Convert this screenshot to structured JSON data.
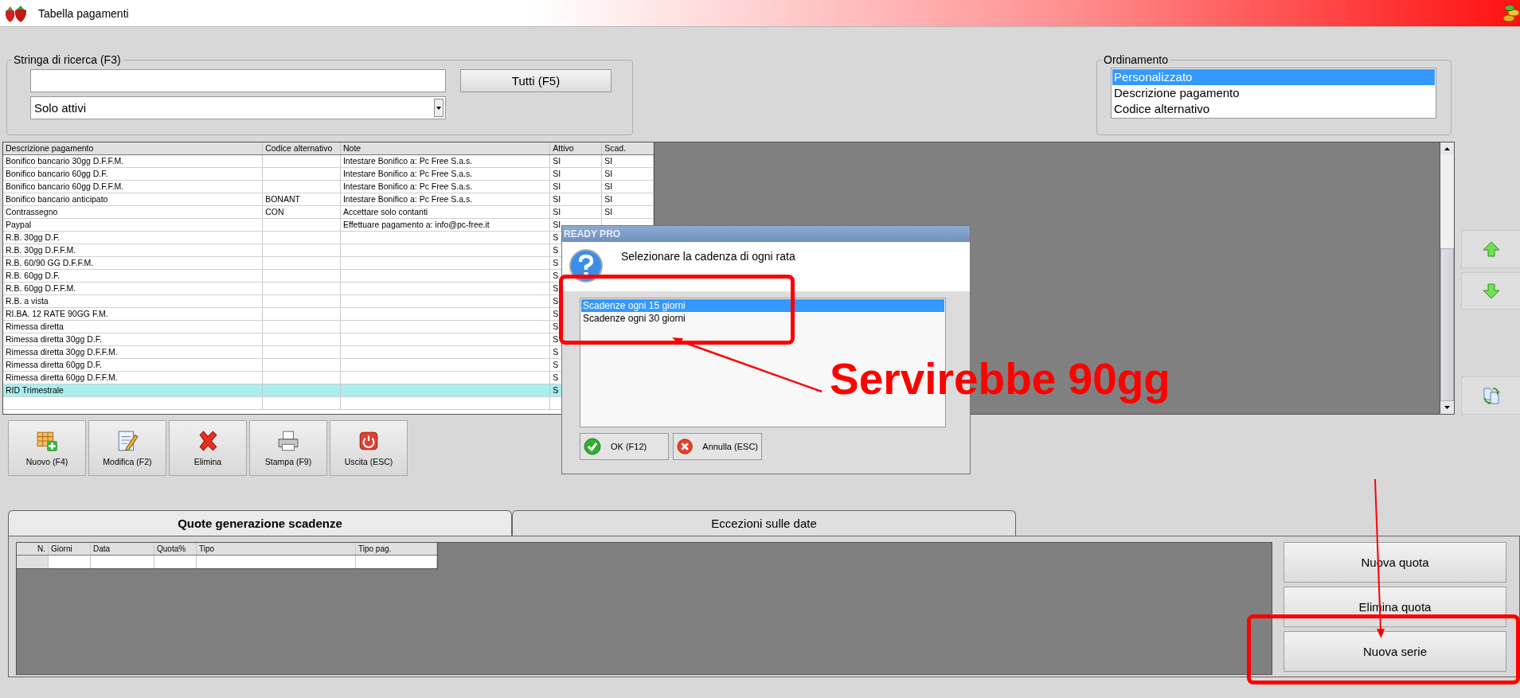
{
  "window": {
    "title": "Tabella pagamenti"
  },
  "search": {
    "group_label": "Stringa di ricerca (F3)",
    "button": "Tutti (F5)",
    "filter": "Solo attivi"
  },
  "sort": {
    "group_label": "Ordinamento",
    "options": [
      {
        "label": "Personalizzato",
        "selected": true
      },
      {
        "label": "Descrizione pagamento",
        "selected": false
      },
      {
        "label": "Codice alternativo",
        "selected": false
      }
    ]
  },
  "table": {
    "columns": [
      "Descrizione pagamento",
      "Codice alternativo",
      "Note",
      "Attivo",
      "Scad."
    ],
    "rows": [
      {
        "description": "Bonifico bancario 30gg D.F.F.M.",
        "note": "Intestare Bonifico a: Pc Free S.a.s.",
        "active": "SI",
        "due": "SI",
        "selected": false
      },
      {
        "description": "Bonifico bancario 60gg D.F.",
        "note": "Intestare Bonifico a: Pc Free S.a.s.",
        "active": "SI",
        "due": "SI",
        "selected": false
      },
      {
        "description": "Bonifico bancario 60gg D.F.F.M.",
        "note": "Intestare Bonifico a: Pc Free S.a.s.",
        "active": "SI",
        "due": "SI",
        "selected": false
      },
      {
        "description": "Bonifico bancario anticipato",
        "code": "BONANT",
        "note": "Intestare Bonifico a: Pc Free S.a.s.",
        "active": "SI",
        "due": "SI",
        "selected": false
      },
      {
        "description": "Contrassegno",
        "code": "CON",
        "note": "Accettare solo contanti",
        "active": "SI",
        "due": "SI",
        "selected": false
      },
      {
        "description": "Paypal",
        "note": "Effettuare pagamento a: info@pc-free.it",
        "active": "SI",
        "selected": false
      },
      {
        "description": "R.B. 30gg D.F.",
        "active": "S",
        "selected": false
      },
      {
        "description": "R.B. 30gg D.F.F.M.",
        "active": "S",
        "selected": false
      },
      {
        "description": "R.B. 60/90 GG D.F.F.M.",
        "active": "S",
        "selected": false
      },
      {
        "description": "R.B. 60gg D.F.",
        "active": "S",
        "selected": false
      },
      {
        "description": "R.B. 60gg D.F.F.M.",
        "active": "S",
        "selected": false
      },
      {
        "description": "R.B. a vista",
        "active": "S",
        "selected": false
      },
      {
        "description": "RI.BA. 12 RATE 90GG F.M.",
        "active": "S",
        "selected": false
      },
      {
        "description": "Rimessa diretta",
        "active": "S",
        "selected": false
      },
      {
        "description": "Rimessa diretta 30gg D.F.",
        "active": "S",
        "selected": false
      },
      {
        "description": "Rimessa diretta 30gg D.F.F.M.",
        "active": "S",
        "selected": false
      },
      {
        "description": "Rimessa diretta 60gg D.F.",
        "active": "S",
        "selected": false
      },
      {
        "description": "Rimessa diretta 60gg D.F.F.M.",
        "active": "S",
        "selected": false
      },
      {
        "description": "RID Trimestrale",
        "active": "S",
        "selected": true
      }
    ]
  },
  "toolbar": [
    {
      "label": "Nuovo (F4)",
      "kind": "new"
    },
    {
      "label": "Modifica (F2)",
      "kind": "edit"
    },
    {
      "label": "Elimina",
      "kind": "delete"
    },
    {
      "label": "Stampa (F9)",
      "kind": "print"
    },
    {
      "label": "Uscita (ESC)",
      "kind": "exit"
    }
  ],
  "dialog": {
    "title": "READY PRO",
    "message": "Selezionare la cadenza di ogni rata",
    "options": [
      {
        "label": "Scadenze ogni 15 giorni",
        "selected": true
      },
      {
        "label": "Scadenze ogni 30 giorni",
        "selected": false
      }
    ],
    "buttons": [
      {
        "label": "OK (F12)",
        "kind": "ok"
      },
      {
        "label": "Annulla (ESC)",
        "kind": "cancel"
      }
    ]
  },
  "tabs": [
    {
      "label": "Quote generazione scadenze",
      "selected": true
    },
    {
      "label": "Eccezioni sulle date",
      "selected": false
    }
  ],
  "quote_table": {
    "columns": [
      "N.",
      "Giorni",
      "Data",
      "Quota%",
      "Tipo",
      "Tipo pag."
    ]
  },
  "actions": [
    "Nuova quota",
    "Elimina quota",
    "Nuova serie"
  ],
  "annotation": {
    "text": "Servirebbe 90gg"
  }
}
